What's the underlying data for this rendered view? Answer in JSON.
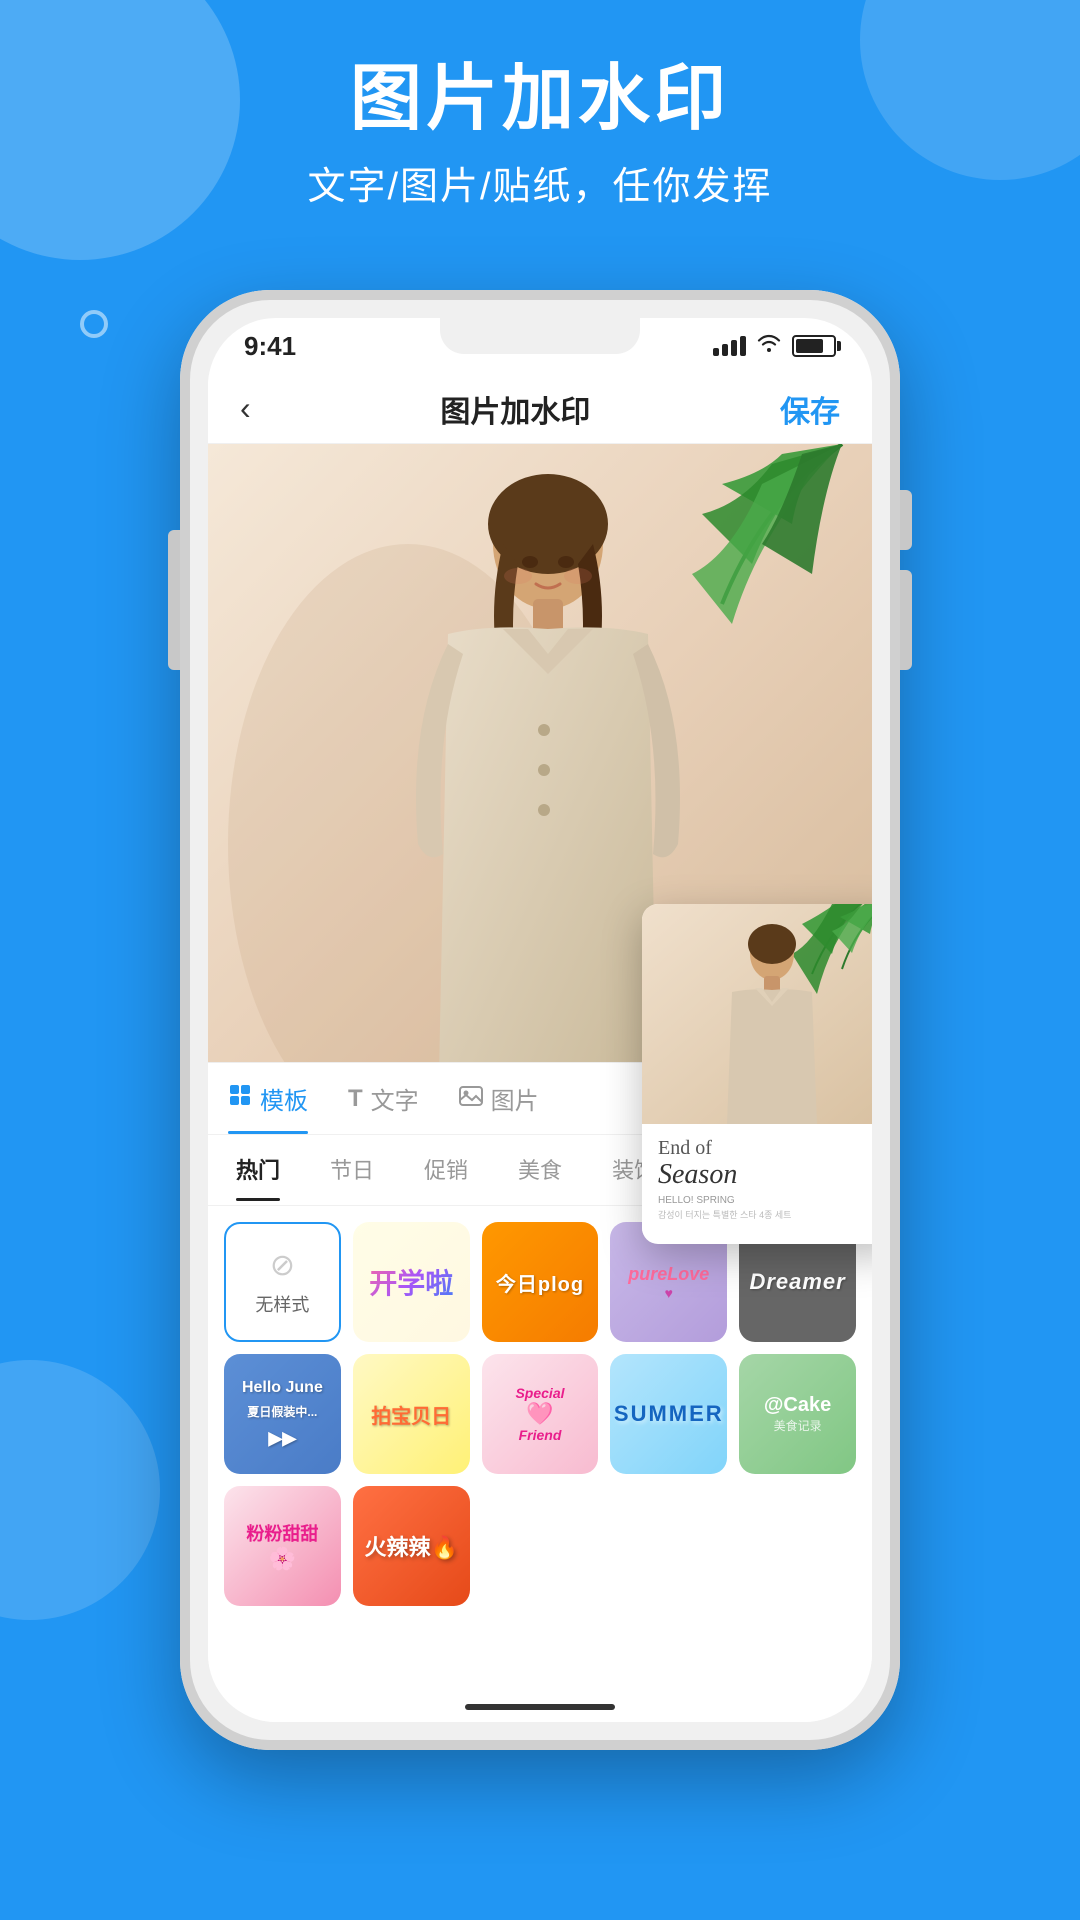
{
  "background": {
    "color": "#2196F3"
  },
  "header": {
    "title": "图片加水印",
    "subtitle": "文字/图片/贴纸，任你发挥"
  },
  "phone": {
    "statusBar": {
      "time": "9:41"
    },
    "navBar": {
      "back": "‹",
      "title": "图片加水印",
      "save": "保存"
    }
  },
  "tabs": [
    {
      "icon": "template-icon",
      "label": "模板",
      "active": true
    },
    {
      "icon": "text-icon",
      "label": "文字",
      "active": false
    },
    {
      "icon": "image-icon",
      "label": "图片",
      "active": false
    }
  ],
  "categories": [
    {
      "label": "热门",
      "active": true
    },
    {
      "label": "节日",
      "active": false
    },
    {
      "label": "促销",
      "active": false
    },
    {
      "label": "美食",
      "active": false
    },
    {
      "label": "装饰",
      "active": false
    }
  ],
  "previewCard": {
    "line1": "End of",
    "line2": "Season",
    "line3": "HELLO! SPRING"
  },
  "stickers": {
    "row1": [
      {
        "id": "no-style",
        "label": "无样式",
        "type": "no-style"
      },
      {
        "id": "kaiyue",
        "label": "开学啦",
        "type": "kaiyue"
      },
      {
        "id": "jinri",
        "label": "今日plog",
        "type": "jinri"
      },
      {
        "id": "love",
        "label": "pureLove",
        "type": "love"
      }
    ],
    "row2": [
      {
        "id": "dreamer",
        "label": "Dreamer",
        "type": "dreamer"
      },
      {
        "id": "hello",
        "label": "Hello June",
        "type": "hello"
      },
      {
        "id": "baobao",
        "label": "拍宝贝日",
        "type": "baobao"
      },
      {
        "id": "special",
        "label": "Special Friend",
        "type": "special"
      }
    ],
    "row3": [
      {
        "id": "summer",
        "label": "SUMMER",
        "type": "summer"
      },
      {
        "id": "cake",
        "label": "@Cake",
        "type": "cake"
      },
      {
        "id": "pink",
        "label": "粉粉甜甜",
        "type": "pink"
      },
      {
        "id": "spicy",
        "label": "火辣辣",
        "type": "spicy"
      }
    ]
  }
}
